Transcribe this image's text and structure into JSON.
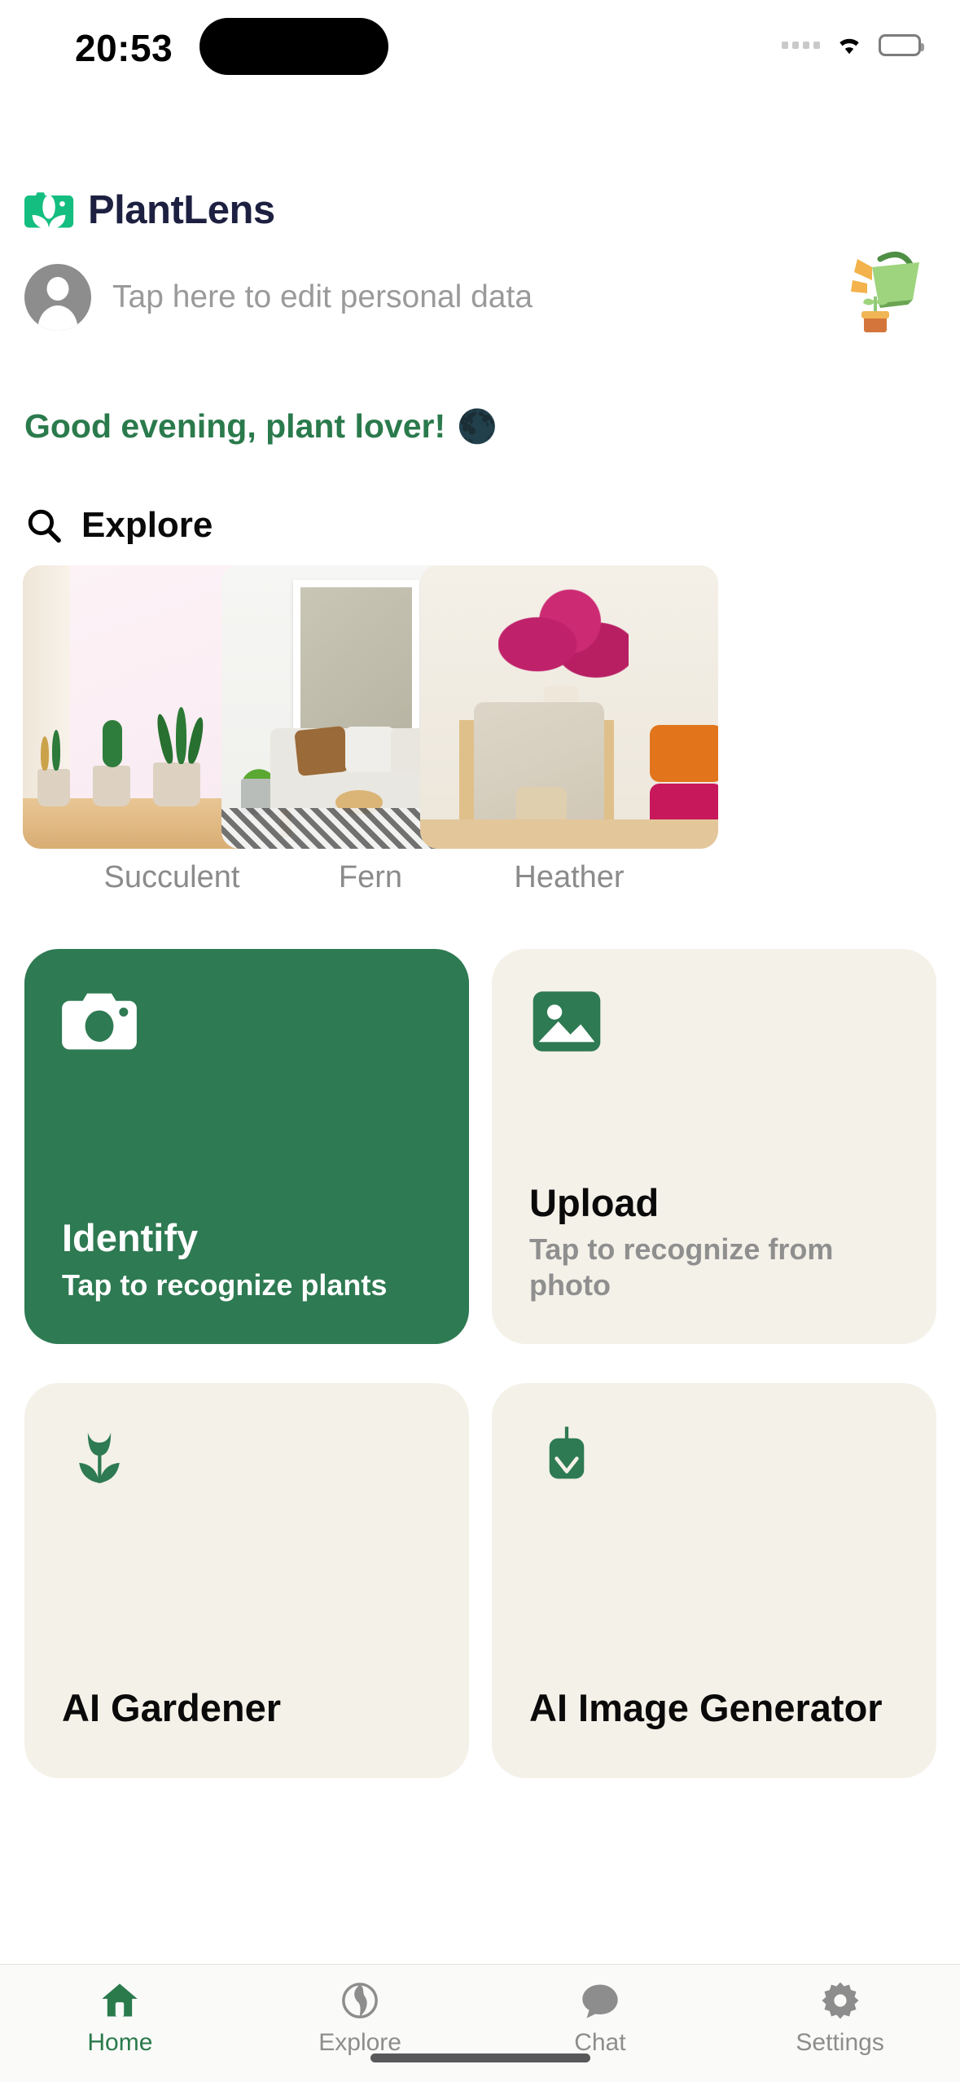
{
  "status_bar": {
    "time": "20:53",
    "signal_icon": "signal-dots-icon",
    "wifi_icon": "wifi-icon",
    "battery_icon": "battery-icon"
  },
  "header": {
    "logo_icon": "plantlens-camera-leaf-logo",
    "app_name": "PlantLens",
    "brand_green": "#14be80",
    "brand_navy": "#1d2040"
  },
  "profile": {
    "avatar_icon": "person-avatar-icon",
    "edit_text": "Tap here to edit personal data",
    "illustration_icon": "watering-can-plant-icon"
  },
  "greeting": {
    "text": "Good evening, plant lover!",
    "emoji": "🌑",
    "color": "#2a7a4c"
  },
  "explore_section": {
    "search_icon": "search-icon",
    "title": "Explore",
    "cards": [
      {
        "label": "Succulent"
      },
      {
        "label": "Fern"
      },
      {
        "label": "Heather"
      }
    ]
  },
  "actions": [
    {
      "icon": "camera-icon",
      "title": "Identify",
      "subtitle": "Tap to recognize plants",
      "bg": "#2e7a52",
      "style": "primary"
    },
    {
      "icon": "image-icon",
      "title": "Upload",
      "subtitle": "Tap to recognize from photo",
      "bg": "#f4f1e9",
      "style": "secondary"
    },
    {
      "icon": "flower-icon",
      "title": "AI Gardener",
      "subtitle": "",
      "bg": "#f4f1e9",
      "style": "secondary"
    },
    {
      "icon": "download-icon",
      "title": "AI Image Generator",
      "subtitle": "",
      "bg": "#f4f1e9",
      "style": "secondary"
    }
  ],
  "tabbar": {
    "items": [
      {
        "label": "Home",
        "icon": "home-icon",
        "active": true
      },
      {
        "label": "Explore",
        "icon": "globe-icon",
        "active": false
      },
      {
        "label": "Chat",
        "icon": "chat-bubble-icon",
        "active": false
      },
      {
        "label": "Settings",
        "icon": "gear-icon",
        "active": false
      }
    ],
    "active_color": "#2a7a4c",
    "inactive_color": "#8d8d8d"
  }
}
